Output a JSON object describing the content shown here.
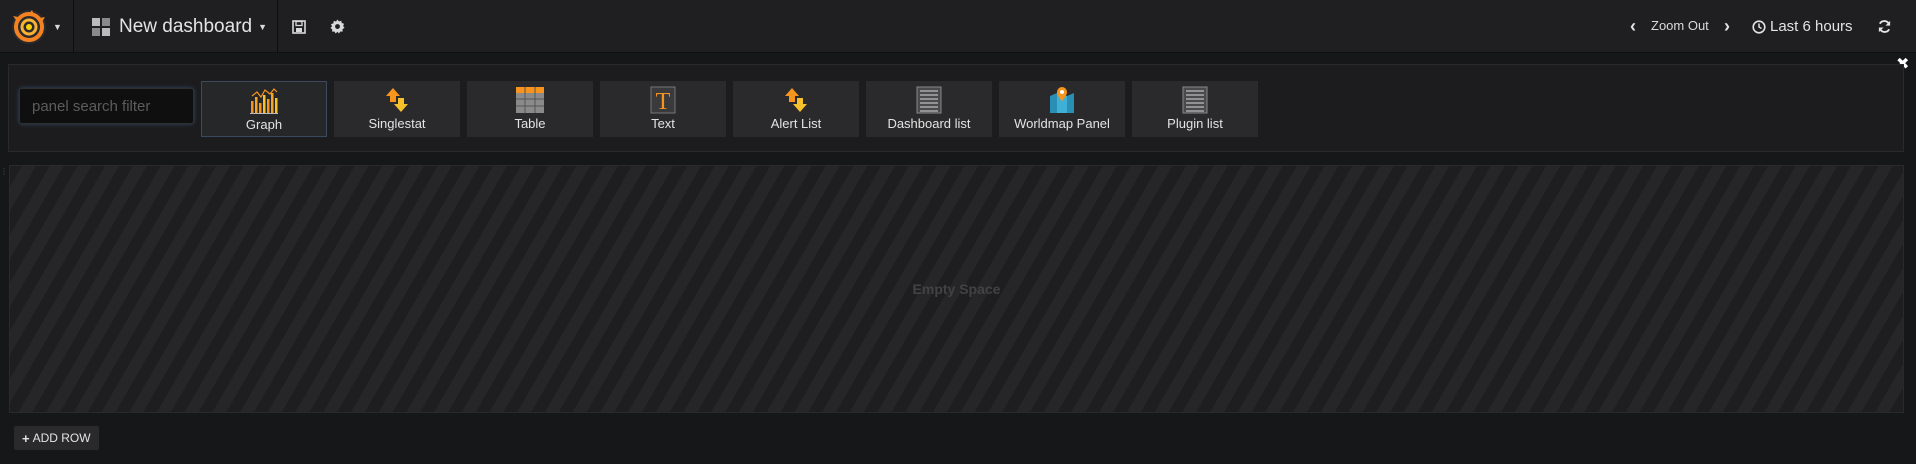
{
  "navbar": {
    "dashboard_title": "New dashboard",
    "zoom_out_label": "Zoom Out",
    "time_range_label": "Last 6 hours",
    "icons": {
      "logo": "grafana-logo-icon",
      "dashboard": "dashboard-grid-icon",
      "save": "save-icon",
      "settings": "gear-icon",
      "zoom_prev": "chevron-left-icon",
      "zoom_next": "chevron-right-icon",
      "clock": "clock-icon",
      "refresh": "refresh-icon"
    }
  },
  "panel_picker": {
    "search_placeholder": "panel search filter",
    "search_value": "",
    "selected": "Graph",
    "panels": [
      {
        "label": "Graph",
        "icon": "graph-icon"
      },
      {
        "label": "Singlestat",
        "icon": "singlestat-icon"
      },
      {
        "label": "Table",
        "icon": "table-icon"
      },
      {
        "label": "Text",
        "icon": "text-icon"
      },
      {
        "label": "Alert List",
        "icon": "alert-list-icon"
      },
      {
        "label": "Dashboard list",
        "icon": "dashboard-list-icon"
      },
      {
        "label": "Worldmap Panel",
        "icon": "worldmap-icon"
      },
      {
        "label": "Plugin list",
        "icon": "plugin-list-icon"
      }
    ],
    "close_icon": "close-icon"
  },
  "row": {
    "empty_text": "Empty Space",
    "add_row_label": "ADD ROW"
  },
  "colors": {
    "background": "#161719",
    "navbar": "#1f1f21",
    "card": "#2a2a2c",
    "accent_orange": "#f7941d",
    "accent_yellow": "#f6c22b"
  }
}
